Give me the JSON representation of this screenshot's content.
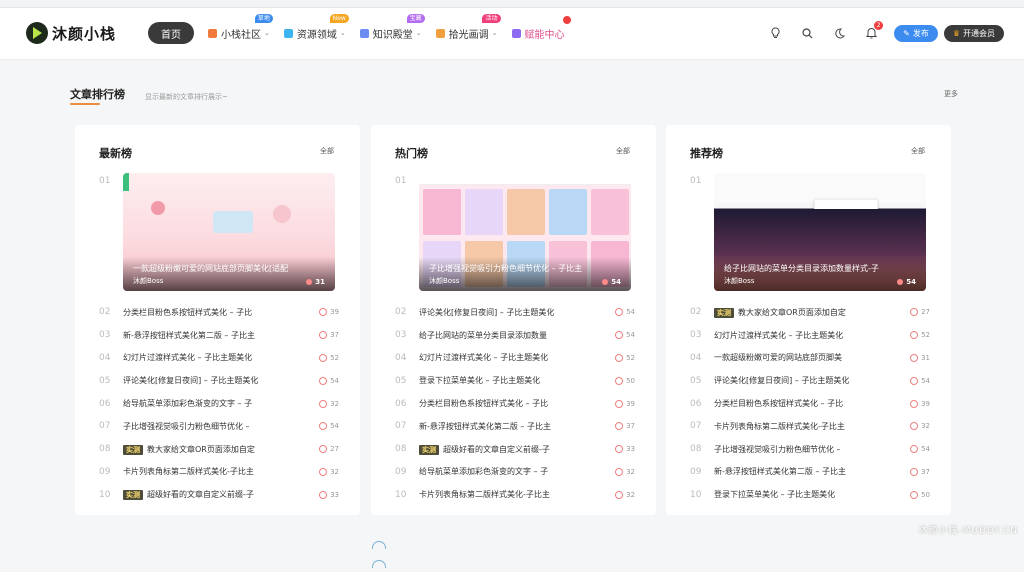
{
  "header": {
    "logo_text": "沐颜小栈",
    "nav": [
      {
        "label": "首页",
        "active": true,
        "icon": "",
        "badge": "",
        "badge_color": "",
        "dropdown": false
      },
      {
        "label": "小栈社区",
        "active": false,
        "icon": "box-icon",
        "badge": "草地",
        "badge_color": "#3c8cf0",
        "dropdown": true
      },
      {
        "label": "资源领域",
        "active": false,
        "icon": "snowflake-icon",
        "badge": "New",
        "badge_color": "#f5a623",
        "dropdown": true
      },
      {
        "label": "知识殿堂",
        "active": false,
        "icon": "book-icon",
        "badge": "宝藏",
        "badge_color": "#b36bf0",
        "dropdown": true
      },
      {
        "label": "拾光画调",
        "active": false,
        "icon": "palette-icon",
        "badge": "活动",
        "badge_color": "#f03e7a",
        "dropdown": true
      },
      {
        "label": "赋能中心",
        "active": false,
        "icon": "home-icon",
        "badge": "",
        "badge_color": "#f03e3e",
        "dropdown": false,
        "pink": true
      }
    ],
    "notification_count": "2",
    "publish_label": "发布",
    "vip_label": "开通会员"
  },
  "section": {
    "title": "文章排行榜",
    "subtitle": "显示最新的文章排行展示~",
    "more_label": "更多"
  },
  "cards": [
    {
      "title": "最新榜",
      "all_label": "全部",
      "featured": {
        "num": "01",
        "title": "一款超级粉嫩可爱的网站底部页脚美化[适配",
        "author": "沐颜Boss",
        "count": "31",
        "art": "art1"
      },
      "items": [
        {
          "num": "02",
          "tag": "",
          "title": "分类栏目粉色系按钮样式美化 – 子比",
          "count": "39"
        },
        {
          "num": "03",
          "tag": "",
          "title": "新-悬浮按钮样式美化第二版 – 子比主",
          "count": "37"
        },
        {
          "num": "04",
          "tag": "",
          "title": "幻灯片过渡样式美化 – 子比主题美化",
          "count": "52"
        },
        {
          "num": "05",
          "tag": "",
          "title": "评论美化[修复日夜间] – 子比主题美化",
          "count": "54"
        },
        {
          "num": "06",
          "tag": "",
          "title": "给导航菜单添加彩色渐变的文字 – 子",
          "count": "32"
        },
        {
          "num": "07",
          "tag": "",
          "title": "子比增强视觉吸引力粉色细节优化 –",
          "count": "54"
        },
        {
          "num": "08",
          "tag": "实测",
          "title": "教大家给文章OR页面添加自定",
          "count": "27"
        },
        {
          "num": "09",
          "tag": "",
          "title": "卡片列表角标第二版样式美化-子比主",
          "count": "32"
        },
        {
          "num": "10",
          "tag": "实测",
          "title": "超级好看的文章自定义前缀-子",
          "count": "33"
        }
      ]
    },
    {
      "title": "热门榜",
      "all_label": "全部",
      "featured": {
        "num": "01",
        "title": "子比增强视觉吸引力粉色细节优化 – 子比主",
        "author": "沐颜Boss",
        "count": "54",
        "art": "art2"
      },
      "items": [
        {
          "num": "02",
          "tag": "",
          "title": "评论美化[修复日夜间] – 子比主题美化",
          "count": "54"
        },
        {
          "num": "03",
          "tag": "",
          "title": "给子比网站的菜单分类目录添加数量",
          "count": "54"
        },
        {
          "num": "04",
          "tag": "",
          "title": "幻灯片过渡样式美化 – 子比主题美化",
          "count": "52"
        },
        {
          "num": "05",
          "tag": "",
          "title": "登录下拉菜单美化 – 子比主题美化",
          "count": "50"
        },
        {
          "num": "06",
          "tag": "",
          "title": "分类栏目粉色系按钮样式美化 – 子比",
          "count": "39"
        },
        {
          "num": "07",
          "tag": "",
          "title": "新-悬浮按钮样式美化第二版 – 子比主",
          "count": "37"
        },
        {
          "num": "08",
          "tag": "实测",
          "title": "超级好看的文章自定义前缀-子",
          "count": "33"
        },
        {
          "num": "09",
          "tag": "",
          "title": "给导航菜单添加彩色渐变的文字 – 子",
          "count": "32"
        },
        {
          "num": "10",
          "tag": "",
          "title": "卡片列表角标第二版样式美化-子比主",
          "count": "32"
        }
      ]
    },
    {
      "title": "推荐榜",
      "all_label": "全部",
      "featured": {
        "num": "01",
        "title": "给子比网站的菜单分类目录添加数量样式-子",
        "author": "沐颜Boss",
        "count": "54",
        "art": "art3"
      },
      "items": [
        {
          "num": "02",
          "tag": "实测",
          "title": "教大家给文章OR页面添加自定",
          "count": "27"
        },
        {
          "num": "03",
          "tag": "",
          "title": "幻灯片过渡样式美化 – 子比主题美化",
          "count": "52"
        },
        {
          "num": "04",
          "tag": "",
          "title": "一款超级粉嫩可爱的网站底部页脚美",
          "count": "31"
        },
        {
          "num": "05",
          "tag": "",
          "title": "评论美化[修复日夜间] – 子比主题美化",
          "count": "54"
        },
        {
          "num": "06",
          "tag": "",
          "title": "分类栏目粉色系按钮样式美化 – 子比",
          "count": "39"
        },
        {
          "num": "07",
          "tag": "",
          "title": "卡片列表角标第二版样式美化-子比主",
          "count": "32"
        },
        {
          "num": "08",
          "tag": "",
          "title": "子比增强视觉吸引力粉色细节优化 –",
          "count": "54"
        },
        {
          "num": "09",
          "tag": "",
          "title": "新-悬浮按钮样式美化第二版 – 子比主",
          "count": "37"
        },
        {
          "num": "10",
          "tag": "",
          "title": "登录下拉菜单美化 – 子比主题美化",
          "count": "50"
        }
      ]
    }
  ],
  "watermark": "沐颜小栈-MUDDY.CN"
}
